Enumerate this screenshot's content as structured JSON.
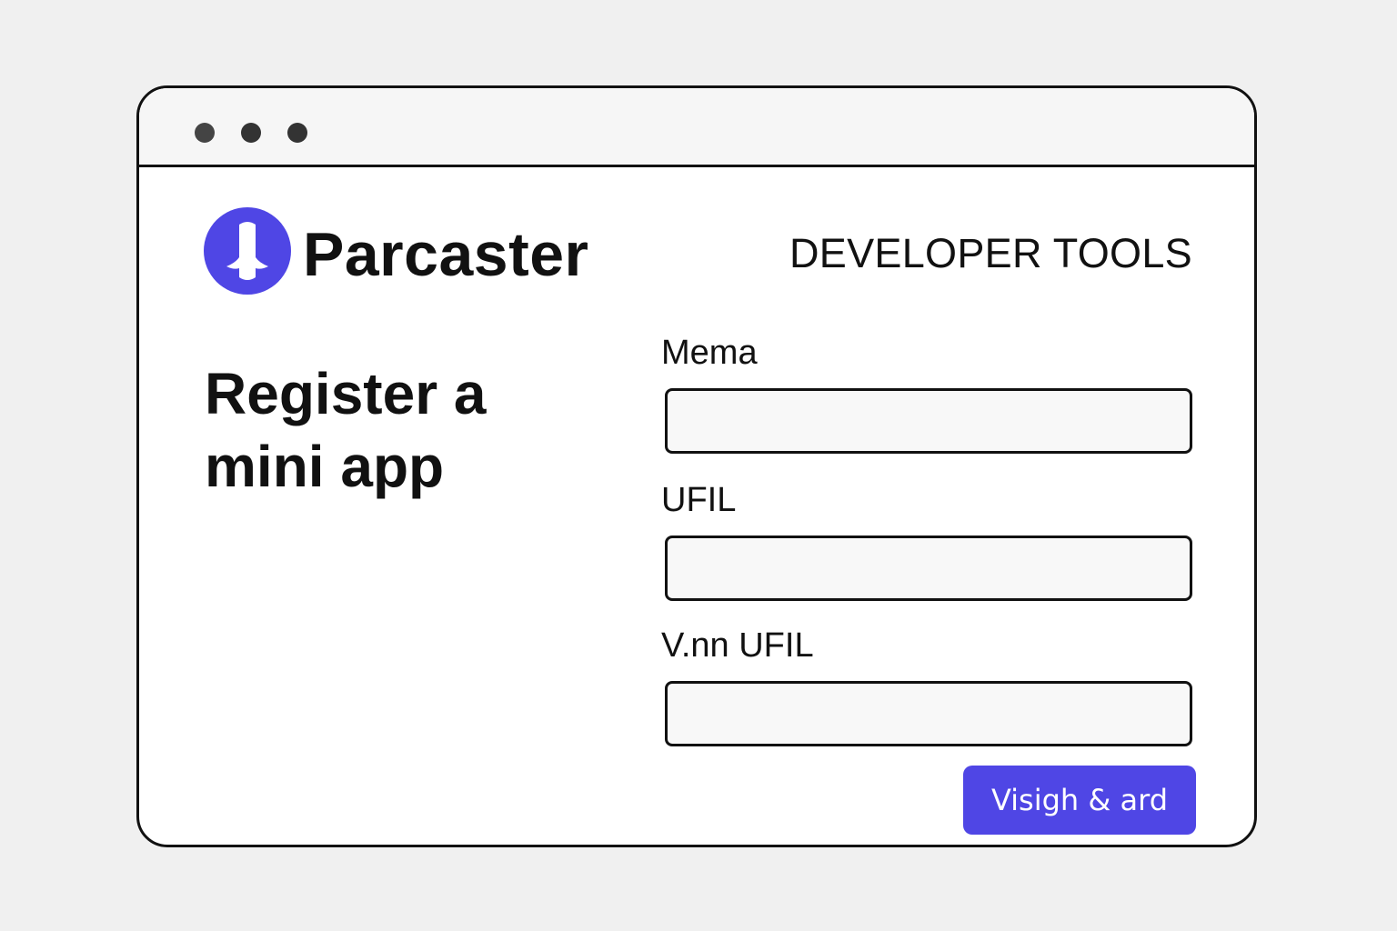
{
  "header": {
    "brand_name": "Parcaster",
    "section_title": "DEVELOPER TOOLS"
  },
  "main": {
    "headline": "Register a mini app"
  },
  "form": {
    "fields": [
      {
        "label": "Mema",
        "value": ""
      },
      {
        "label": "UFIL",
        "value": ""
      },
      {
        "label": "V.nn UFIL",
        "value": ""
      }
    ],
    "submit_label": "Visigh & ard"
  },
  "colors": {
    "accent": "#4f46e5",
    "page_background": "#f0f0f0",
    "window_background": "#ffffff",
    "border": "#111111"
  },
  "icons": {
    "logo": "parcaster-logo-icon"
  }
}
